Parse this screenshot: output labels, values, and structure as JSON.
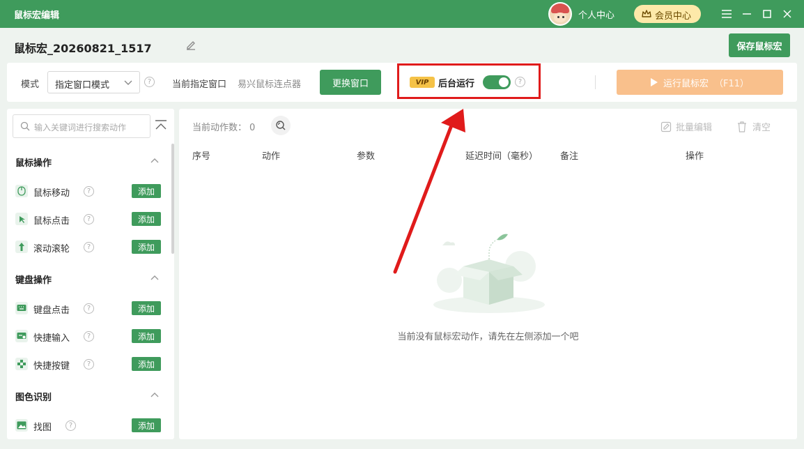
{
  "titlebar": {
    "title": "鼠标宏编辑",
    "user_center": "个人中心",
    "vip_center": "会员中心"
  },
  "header": {
    "macro_name": "鼠标宏_20260821_1517",
    "save_label": "保存鼠标宏"
  },
  "toolbar": {
    "mode_label": "模式",
    "mode_value": "指定窗口模式",
    "current_window_label": "当前指定窗口",
    "current_window_value": "易兴鼠标连点器",
    "change_window_label": "更换窗口",
    "vip_tag": "VIP",
    "background_run_label": "后台运行",
    "background_run_enabled": true,
    "run_label": "运行鼠标宏",
    "run_shortcut": "（F11）"
  },
  "sidebar": {
    "search_placeholder": "输入关键词进行搜索动作",
    "add_label": "添加",
    "categories": [
      {
        "title": "鼠标操作",
        "items": [
          "鼠标移动",
          "鼠标点击",
          "滚动滚轮"
        ]
      },
      {
        "title": "键盘操作",
        "items": [
          "键盘点击",
          "快捷输入",
          "快捷按键"
        ]
      },
      {
        "title": "图色识别",
        "items": [
          "找图"
        ]
      }
    ]
  },
  "main": {
    "count_label": "当前动作数：",
    "count_value": "0",
    "batch_edit": "批量编辑",
    "clear": "清空",
    "columns": [
      "序号",
      "动作",
      "参数",
      "延迟时间（毫秒）",
      "备注",
      "操作"
    ],
    "empty_message": "当前没有鼠标宏动作，请先在左侧添加一个吧"
  },
  "colors": {
    "brand_green": "#3f9b5c",
    "run_disabled": "#f9c08c",
    "highlight_red": "#e01b1b",
    "vip_gold": "#f5c247"
  }
}
